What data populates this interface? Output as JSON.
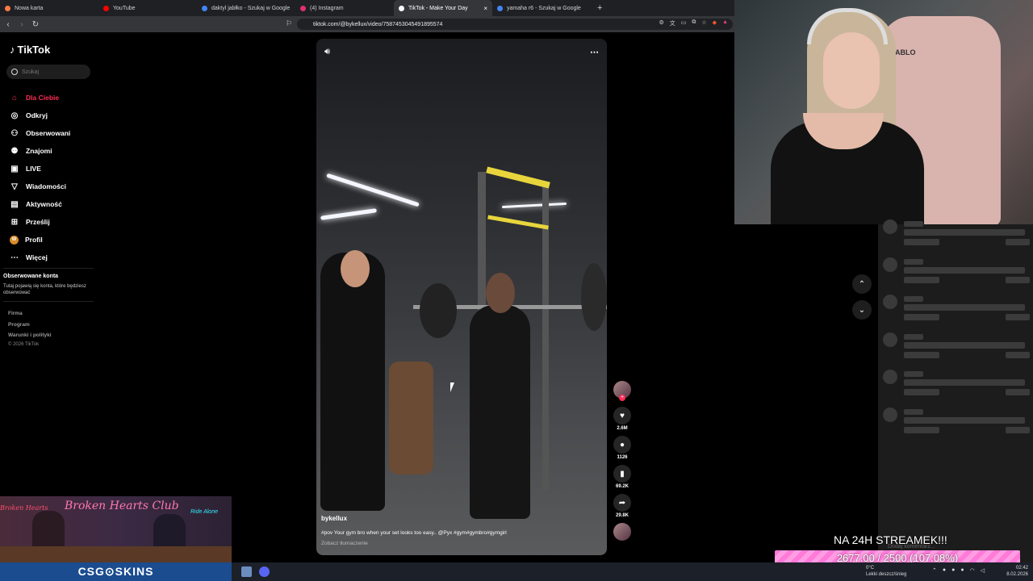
{
  "browser": {
    "tabs": [
      {
        "title": "Nowa karta",
        "color": "#ff7a45"
      },
      {
        "title": "YouTube",
        "color": "#ff0000"
      },
      {
        "title": "daktyl jabłko - Szukaj w Google",
        "color": "#4285f4"
      },
      {
        "title": "(4) Instagram",
        "color": "#e1306c"
      },
      {
        "title": "TikTok - Make Your Day",
        "color": "#ffffff",
        "active": true
      },
      {
        "title": "yamaha r6 - Szukaj w Google",
        "color": "#4285f4"
      }
    ],
    "new_tab": "+",
    "close": "×",
    "url": "tiktok.com/@bykellux/video/7587453045491895574"
  },
  "tiktok": {
    "logo": "TikTok",
    "search_placeholder": "Szukaj",
    "menu": [
      {
        "label": "Dla Ciebie",
        "icon": "home-icon",
        "glyph": "⌂",
        "active": true
      },
      {
        "label": "Odkryj",
        "icon": "compass-icon",
        "glyph": "◎"
      },
      {
        "label": "Obserwowani",
        "icon": "follow-icon",
        "glyph": "⚇"
      },
      {
        "label": "Znajomi",
        "icon": "friends-icon",
        "glyph": "⚉"
      },
      {
        "label": "LIVE",
        "icon": "live-icon",
        "glyph": "▣"
      },
      {
        "label": "Wiadomości",
        "icon": "messages-icon",
        "glyph": "▽"
      },
      {
        "label": "Aktywność",
        "icon": "activity-icon",
        "glyph": "▤"
      },
      {
        "label": "Prześlij",
        "icon": "upload-icon",
        "glyph": "⊞"
      },
      {
        "label": "Profil",
        "icon": "profile-icon",
        "glyph": "W"
      },
      {
        "label": "Więcej",
        "icon": "more-icon",
        "glyph": "⋯"
      }
    ],
    "followed_title": "Obserwowane konta",
    "followed_text": "Tutaj pojawią się konta, które będziesz obserwować",
    "footer_links": [
      "Firma",
      "Program",
      "Warunki i polityki"
    ],
    "copyright": "© 2026 TikTok",
    "video": {
      "author": "bykellux",
      "caption": "#pov Your gym bro when your set looks too easy.. @Pyx #gym#gymbro#gymgirl",
      "translate": "Zobacz tłumaczenie",
      "likes": "2.6M",
      "comments": "1126",
      "saves": "69.2K",
      "shares": "29.8K"
    }
  },
  "overlay": {
    "stream_title": "NA 24H STREAMEK!!!",
    "goal_text": "2677.00 / 2500 (107.08%)",
    "goal_progress": 1.0708,
    "bhc_title": "Broken Hearts Club",
    "bhc_neon_left": "Broken Hearts",
    "bhc_neon_right": "Ride Alone",
    "sponsor": "CSG⊙SKINS",
    "chat_input_placeholder": "Dodaj komentarz..."
  },
  "webcam": {
    "chair_brand": "DIABLO"
  },
  "taskbar": {
    "weather_temp": "0°C",
    "weather_text": "Lekki deszcz/śnieg",
    "time": "02:42",
    "date": "8.02.2026"
  }
}
